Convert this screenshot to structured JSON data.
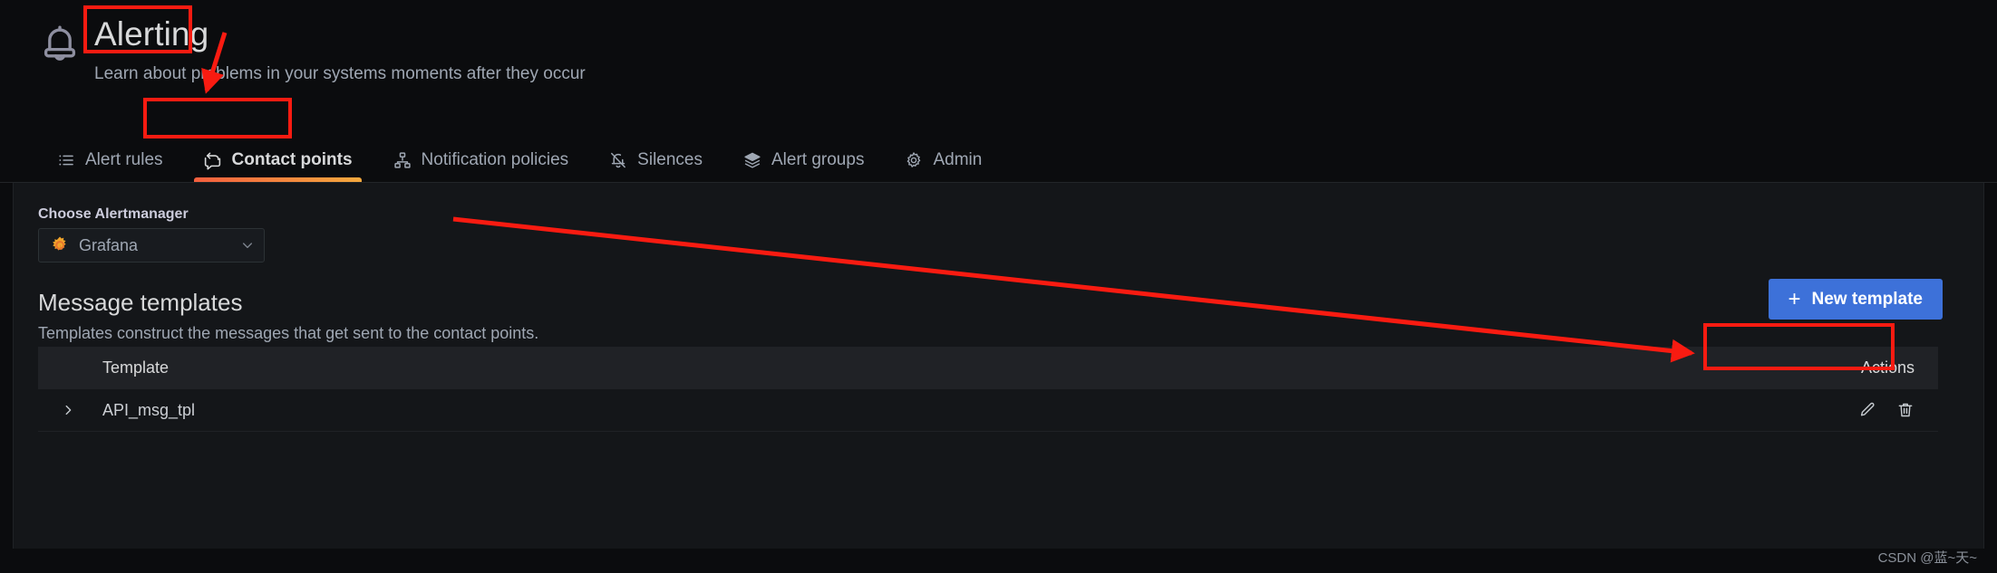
{
  "header": {
    "icon": "bell-icon",
    "title": "Alerting",
    "subtitle": "Learn about problems in your systems moments after they occur"
  },
  "tabs": [
    {
      "label": "Alert rules",
      "icon": "list-ul-icon",
      "active": false
    },
    {
      "label": "Contact points",
      "icon": "comment-share-icon",
      "active": true
    },
    {
      "label": "Notification policies",
      "icon": "sitemap-icon",
      "active": false
    },
    {
      "label": "Silences",
      "icon": "bell-slash-icon",
      "active": false
    },
    {
      "label": "Alert groups",
      "icon": "layer-group-icon",
      "active": false
    },
    {
      "label": "Admin",
      "icon": "cog-icon",
      "active": false
    }
  ],
  "alertmanager": {
    "label": "Choose Alertmanager",
    "selected": "Grafana",
    "icon": "grafana-logo-icon",
    "chevron": "chevron-down-icon"
  },
  "templates_section": {
    "title": "Message templates",
    "description": "Templates construct the messages that get sent to the contact points.",
    "new_button": {
      "label": "New template",
      "icon": "plus-icon"
    }
  },
  "table": {
    "columns": [
      "Template",
      "Actions"
    ],
    "rows": [
      {
        "expand_icon": "chevron-right-icon",
        "name": "API_msg_tpl",
        "actions": [
          "pencil-icon",
          "trash-icon"
        ]
      }
    ]
  },
  "watermark": "CSDN @蓝~天~",
  "colors": {
    "page_background": "#0b0c0e",
    "panel_background": "#141619",
    "table_header_background": "#202226",
    "primary_button": "#3d71d9",
    "active_tab_underline_start": "#f55f3e",
    "active_tab_underline_end": "#f5a93e",
    "annotation_red": "#f91b11",
    "text_primary": "#d8d9da",
    "text_secondary": "#9fa7b3"
  }
}
